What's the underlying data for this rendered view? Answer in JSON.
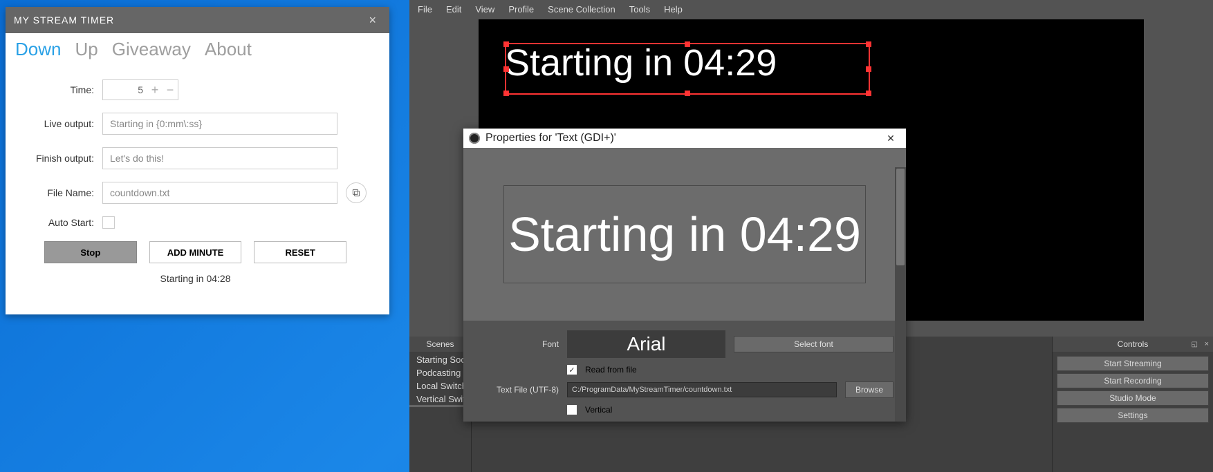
{
  "mst": {
    "title": "MY STREAM TIMER",
    "tabs": [
      "Down",
      "Up",
      "Giveaway",
      "About"
    ],
    "active_tab": 0,
    "labels": {
      "time": "Time:",
      "live_output": "Live output:",
      "finish_output": "Finish output:",
      "file_name": "File Name:",
      "auto_start": "Auto Start:"
    },
    "time_value": "5",
    "live_output": "Starting in {0:mm\\:ss}",
    "finish_output": "Let's do this!",
    "file_name": "countdown.txt",
    "buttons": {
      "stop": "Stop",
      "add_minute": "ADD MINUTE",
      "reset": "RESET"
    },
    "status": "Starting in 04:28"
  },
  "obs": {
    "menu": [
      "File",
      "Edit",
      "View",
      "Profile",
      "Scene Collection",
      "Tools",
      "Help"
    ],
    "preview_text": "Starting in 04:29",
    "dialog": {
      "title": "Properties for 'Text (GDI+)'",
      "preview_text": "Starting in 04:29",
      "font_label": "Font",
      "font_name": "Arial",
      "select_font": "Select font",
      "read_from_file": "Read from file",
      "text_file_label": "Text File (UTF-8)",
      "text_file_path": "C:/ProgramData/MyStreamTimer/countdown.txt",
      "browse": "Browse",
      "vertical": "Vertical"
    },
    "scenes_header": "Scenes",
    "scenes": [
      "Starting Soo",
      "Podcasting",
      "Local Switch",
      "Vertical Swit"
    ],
    "controls_header": "Controls",
    "controls": [
      "Start Streaming",
      "Start Recording",
      "Studio Mode",
      "Settings"
    ]
  }
}
